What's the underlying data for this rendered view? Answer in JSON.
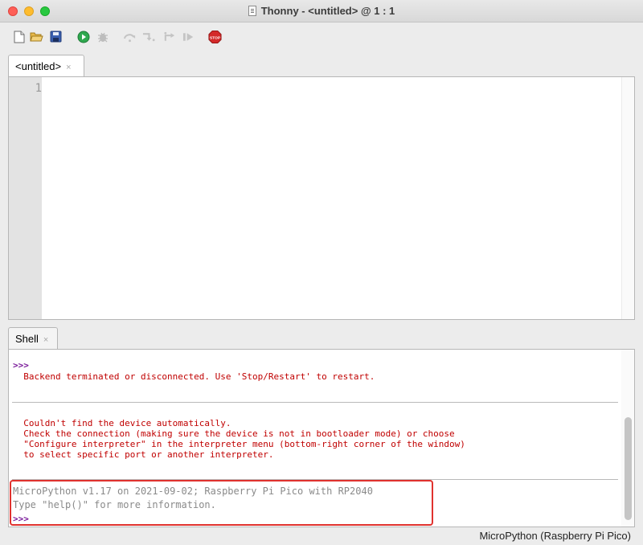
{
  "window": {
    "title": "Thonny  -  <untitled>  @  1 : 1"
  },
  "toolbar": {
    "buttons": [
      {
        "icon": "new-file-icon"
      },
      {
        "icon": "open-folder-icon"
      },
      {
        "icon": "save-icon"
      },
      {
        "icon": "run-icon"
      },
      {
        "icon": "debug-icon"
      },
      {
        "icon": "step-over-icon"
      },
      {
        "icon": "step-into-icon"
      },
      {
        "icon": "step-out-icon"
      },
      {
        "icon": "resume-icon"
      },
      {
        "icon": "stop-icon",
        "label": "STOP"
      }
    ]
  },
  "editor": {
    "tab_label": "<untitled>",
    "tab_close": "×",
    "line_numbers": [
      "1"
    ],
    "content": ""
  },
  "shell": {
    "tab_label": "Shell",
    "tab_close": "×",
    "prompt": ">>>",
    "backend_error": "  Backend terminated or disconnected. Use 'Stop/Restart' to restart.",
    "device_error": [
      "  Couldn't find the device automatically.",
      "  Check the connection (making sure the device is not in bootloader mode) or choose",
      "  \"Configure interpreter\" in the interpreter menu (bottom-right corner of the window)",
      "  to select specific port or another interpreter."
    ],
    "banner": [
      "MicroPython v1.17 on 2021-09-02; Raspberry Pi Pico with RP2040",
      "Type \"help()\" for more information."
    ]
  },
  "status_bar": {
    "interpreter": "MicroPython (Raspberry Pi Pico)"
  },
  "colors": {
    "error": "#c00000",
    "prompt": "#7a1a9a",
    "highlight": "#e0322e"
  }
}
